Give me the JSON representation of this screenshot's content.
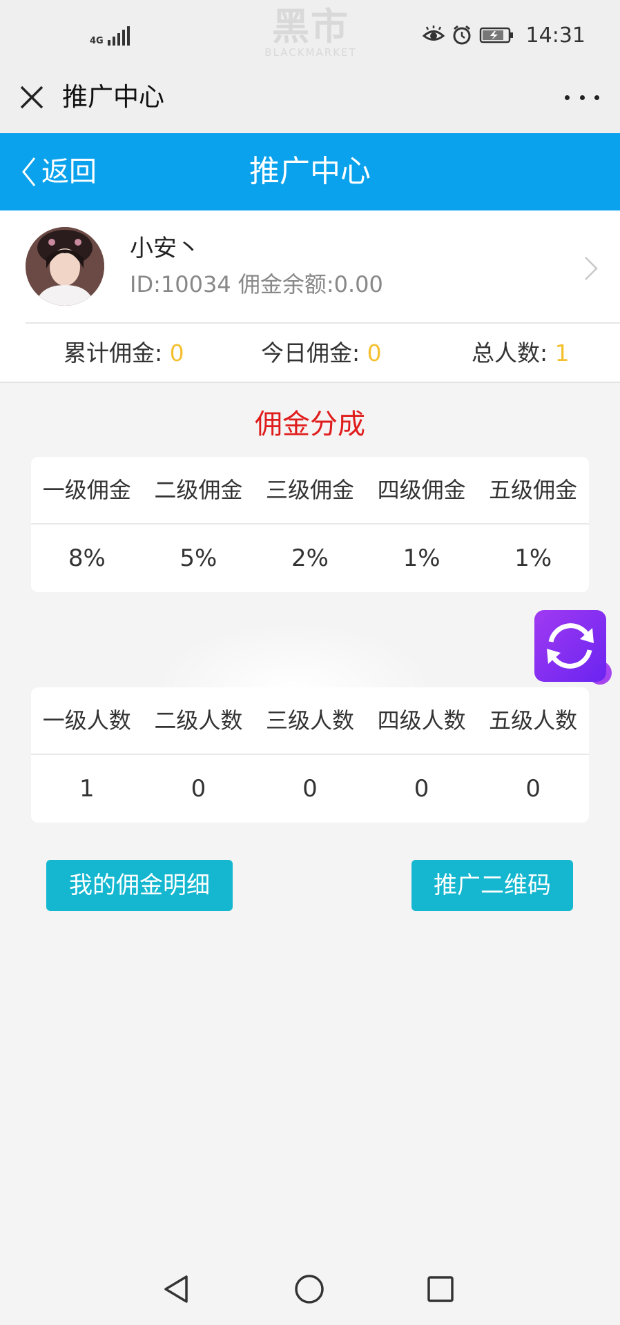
{
  "status_bar": {
    "network": "4G",
    "watermark_main": "黑市",
    "watermark_sub": "BLACKMARKET",
    "time": "14:31",
    "icons": [
      "signal-icon",
      "eye-icon",
      "alarm-icon",
      "battery-charging-icon"
    ]
  },
  "webview": {
    "title": "推广中心",
    "close_icon": "close-icon",
    "more_icon": "more-icon"
  },
  "header": {
    "back_label": "返回",
    "title": "推广中心",
    "color": "#0aa2ec"
  },
  "profile": {
    "name": "小安丶",
    "meta": "ID:10034 佣金余额:0.00",
    "stats": [
      {
        "label": "累计佣金: ",
        "value": "0"
      },
      {
        "label": "今日佣金: ",
        "value": "0"
      },
      {
        "label": "总人数: ",
        "value": "1"
      }
    ]
  },
  "commission": {
    "title": "佣金分成",
    "headers": [
      "一级佣金",
      "二级佣金",
      "三级佣金",
      "四级佣金",
      "五级佣金"
    ],
    "values": [
      "8%",
      "5%",
      "2%",
      "1%",
      "1%"
    ]
  },
  "members": {
    "headers": [
      "一级人数",
      "二级人数",
      "三级人数",
      "四级人数",
      "五级人数"
    ],
    "values": [
      "1",
      "0",
      "0",
      "0",
      "0"
    ]
  },
  "actions": {
    "commission_detail": "我的佣金明细",
    "qr_code": "推广二维码",
    "button_color": "#14b7cf"
  },
  "colors": {
    "accent_red": "#e01d1d",
    "stat_value": "#f5c030",
    "fab": "#7b2cf0"
  }
}
